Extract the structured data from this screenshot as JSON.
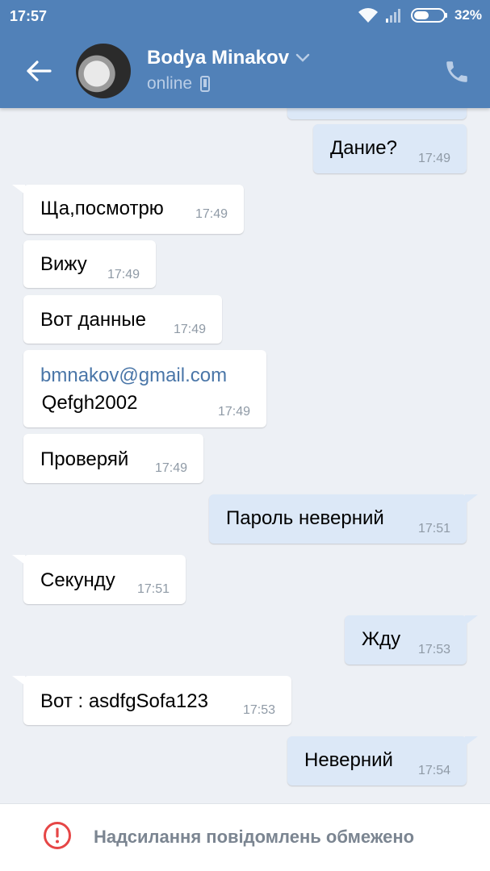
{
  "status_bar": {
    "time": "17:57",
    "battery": "32%",
    "icons": [
      "wifi-icon",
      "signal-icon",
      "battery-icon"
    ]
  },
  "header": {
    "contact_name": "Bodya Minakov",
    "contact_status": "online",
    "icons": [
      "back-arrow-icon",
      "chevron-down-icon",
      "phone-icon",
      "call-icon"
    ]
  },
  "messages": [
    {
      "direction": "out",
      "text": "Дание?",
      "time": "17:49"
    },
    {
      "direction": "in",
      "text": "Ща,посмотрю",
      "time": "17:49"
    },
    {
      "direction": "in",
      "text": "Вижу",
      "time": "17:49"
    },
    {
      "direction": "in",
      "text": "Вот данные",
      "time": "17:49"
    },
    {
      "direction": "in",
      "link": "bmnakov@gmail.com",
      "text": " Qefgh2002",
      "time": "17:49"
    },
    {
      "direction": "in",
      "text": "Проверяй",
      "time": "17:49"
    },
    {
      "direction": "out",
      "text": "Пароль неверний",
      "time": "17:51"
    },
    {
      "direction": "in",
      "text": "Секунду",
      "time": "17:51"
    },
    {
      "direction": "out",
      "text": "Жду",
      "time": "17:53"
    },
    {
      "direction": "in",
      "text": "Вот : asdfgSofa123",
      "time": "17:53"
    },
    {
      "direction": "out",
      "text": "Неверний",
      "time": "17:54"
    }
  ],
  "footer": {
    "notice": "Надсилання повідомлень обмежено",
    "icon": "warning-icon"
  },
  "colors": {
    "header": "#5181b8",
    "background": "#edf0f5",
    "incoming_bubble": "#ffffff",
    "outgoing_bubble": "#dce8f7",
    "warning": "#e64646",
    "link": "#4a76a8"
  }
}
